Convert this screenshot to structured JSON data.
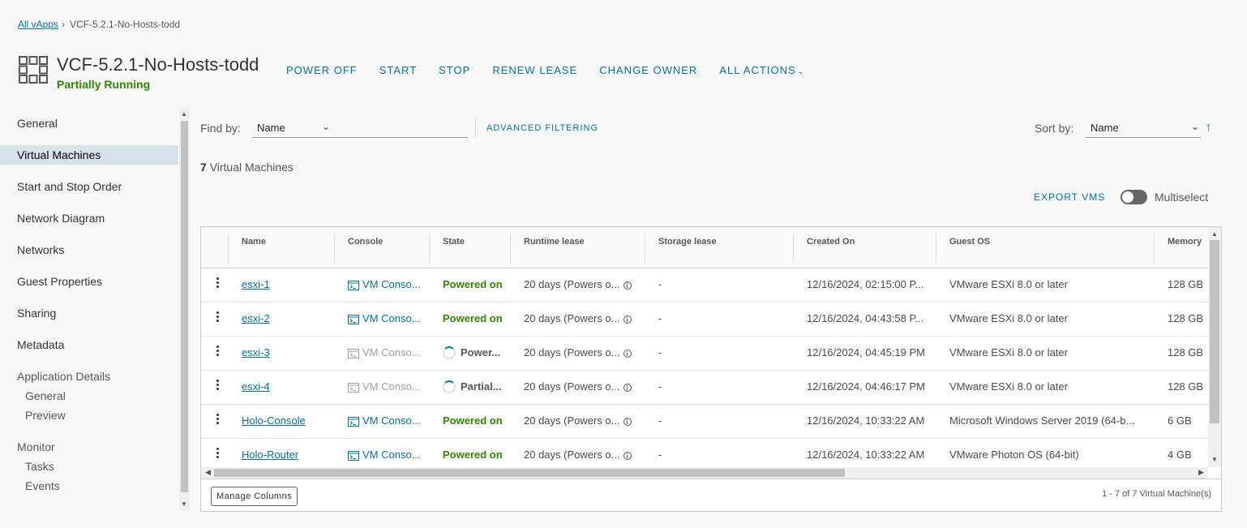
{
  "breadcrumb": {
    "parent": "All vApps",
    "current": "VCF-5.2.1-No-Hosts-todd"
  },
  "header": {
    "title": "VCF-5.2.1-No-Hosts-todd",
    "status": "Partially Running",
    "actions": [
      "POWER OFF",
      "START",
      "STOP",
      "RENEW LEASE",
      "CHANGE OWNER",
      "ALL ACTIONS"
    ]
  },
  "sidebar": {
    "items": [
      "General",
      "Virtual Machines",
      "Start and Stop Order",
      "Network Diagram",
      "Networks",
      "Guest Properties",
      "Sharing",
      "Metadata"
    ],
    "active": "Virtual Machines",
    "groups": [
      {
        "label": "Application Details",
        "children": [
          "General",
          "Preview"
        ]
      },
      {
        "label": "Monitor",
        "children": [
          "Tasks",
          "Events"
        ]
      }
    ]
  },
  "toolbar": {
    "find_by_label": "Find by:",
    "find_by_value": "Name",
    "advanced_filtering": "ADVANCED FILTERING",
    "sort_by_label": "Sort by:",
    "sort_by_value": "Name",
    "sort_direction_icon": "arrow-up-icon"
  },
  "summary": {
    "count": "7",
    "label": "Virtual Machines"
  },
  "export_label": "EXPORT VMS",
  "multiselect": {
    "label": "Multiselect",
    "enabled": false
  },
  "table": {
    "columns": [
      "Name",
      "Console",
      "State",
      "Runtime lease",
      "Storage lease",
      "Created On",
      "Guest OS",
      "Memory"
    ],
    "rows": [
      {
        "name": "esxi-1",
        "console": "VM Conso...",
        "console_enabled": true,
        "state": "Powered on",
        "state_kind": "on",
        "runtime": "20 days (Powers o...",
        "storage": "-",
        "created": "12/16/2024, 02:15:00 P...",
        "os": "VMware ESXi 8.0 or later",
        "memory": "128 GB"
      },
      {
        "name": "esxi-2",
        "console": "VM Conso...",
        "console_enabled": true,
        "state": "Powered on",
        "state_kind": "on",
        "runtime": "20 days (Powers o...",
        "storage": "-",
        "created": "12/16/2024, 04:43:58 P...",
        "os": "VMware ESXi 8.0 or later",
        "memory": "128 GB"
      },
      {
        "name": "esxi-3",
        "console": "VM Conso...",
        "console_enabled": false,
        "state": "Power...",
        "state_kind": "busy",
        "runtime": "20 days (Powers o...",
        "storage": "-",
        "created": "12/16/2024, 04:45:19 PM",
        "os": "VMware ESXi 8.0 or later",
        "memory": "128 GB"
      },
      {
        "name": "esxi-4",
        "console": "VM Conso...",
        "console_enabled": false,
        "state": "Partial...",
        "state_kind": "busy",
        "runtime": "20 days (Powers o...",
        "storage": "-",
        "created": "12/16/2024, 04:46:17 PM",
        "os": "VMware ESXi 8.0 or later",
        "memory": "128 GB"
      },
      {
        "name": "Holo-Console",
        "console": "VM Conso...",
        "console_enabled": true,
        "state": "Powered on",
        "state_kind": "on",
        "runtime": "20 days (Powers o...",
        "storage": "-",
        "created": "12/16/2024, 10:33:22 AM",
        "os": "Microsoft Windows Server 2019 (64-b...",
        "memory": "6 GB"
      },
      {
        "name": "Holo-Router",
        "console": "VM Conso...",
        "console_enabled": true,
        "state": "Powered on",
        "state_kind": "on",
        "runtime": "20 days (Powers o...",
        "storage": "-",
        "created": "12/16/2024, 10:33:22 AM",
        "os": "VMware Photon OS (64-bit)",
        "memory": "4 GB"
      }
    ]
  },
  "footer": {
    "manage_columns": "Manage Columns",
    "pagination": "1 - 7 of 7 Virtual Machine(s)"
  },
  "colors": {
    "accent": "#0072a3",
    "running": "#318700",
    "active_nav": "#d8e3e9"
  }
}
